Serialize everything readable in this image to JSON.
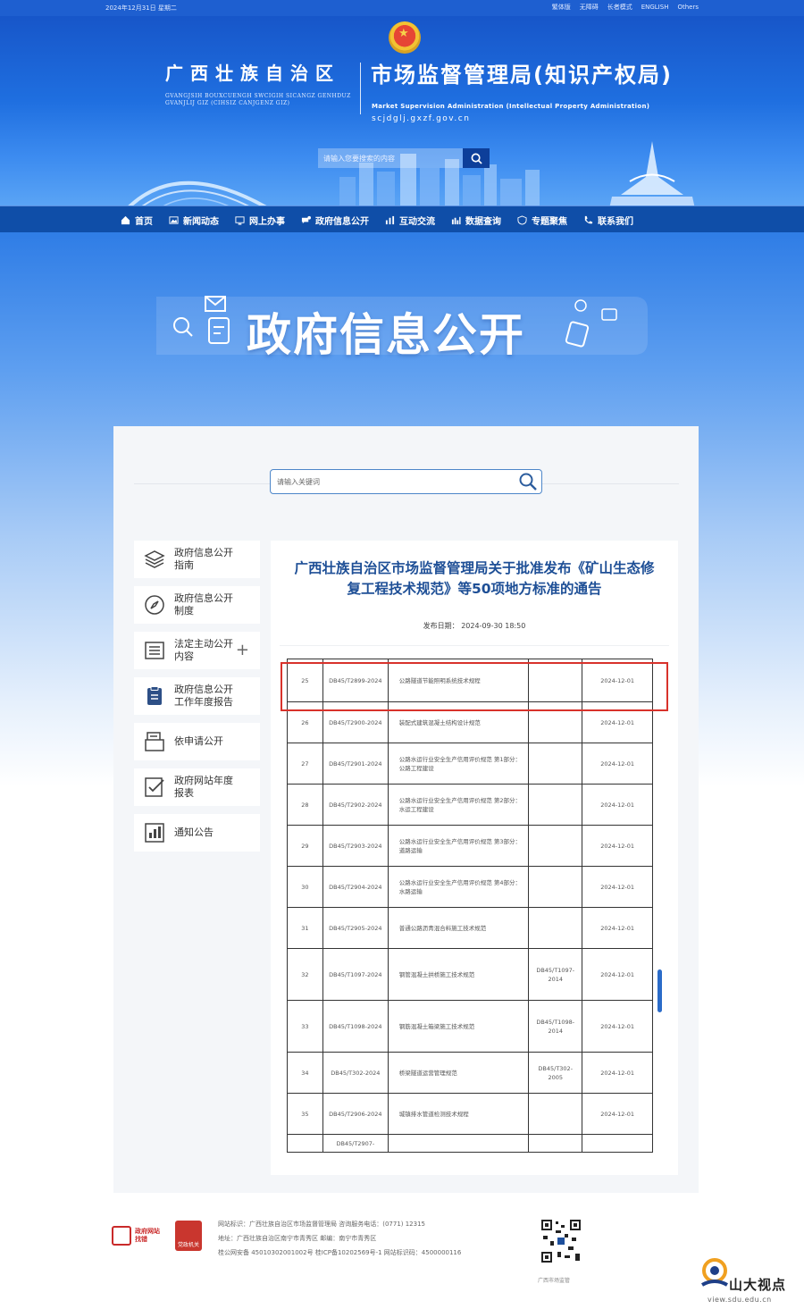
{
  "topbar": {
    "date": "2024年12月31日 星期二",
    "links": [
      "繁体版",
      "无障碍",
      "长者模式",
      "ENGLISH",
      "Others"
    ]
  },
  "header": {
    "region": "广西壮族自治区",
    "region_zhuang": "GVANGJSIH BOUXCUENGH SWCIGIH SICANGZ GENHDUZ GVANJLIJ GIZ (CIHSIZ CANJGENZ GIZ)",
    "agency": "市场监督管理局(知识产权局)",
    "agency_en": "Market Supervision Administration (Intellectual Property Administration)",
    "domain": "scjdglj.gxzf.gov.cn",
    "search_placeholder": "请输入您要搜索的内容"
  },
  "nav": {
    "items": [
      {
        "label": "首页",
        "icon": "home-icon"
      },
      {
        "label": "新闻动态",
        "icon": "image-icon"
      },
      {
        "label": "网上办事",
        "icon": "monitor-icon"
      },
      {
        "label": "政府信息公开",
        "icon": "chat-icon"
      },
      {
        "label": "互动交流",
        "icon": "bar-chart-icon"
      },
      {
        "label": "数据查询",
        "icon": "data-icon"
      },
      {
        "label": "专题聚焦",
        "icon": "shield-icon"
      },
      {
        "label": "联系我们",
        "icon": "phone-icon"
      }
    ]
  },
  "hero": {
    "title": "政府信息公开"
  },
  "content_search": {
    "placeholder": "请输入关键词"
  },
  "sidebar": {
    "items": [
      {
        "label": "政府信息公开指南",
        "icon": "layers-icon",
        "expandable": false
      },
      {
        "label": "政府信息公开制度",
        "icon": "compass-icon",
        "expandable": false
      },
      {
        "label": "法定主动公开内容",
        "icon": "list-icon",
        "expandable": true
      },
      {
        "label": "政府信息公开工作年度报告",
        "icon": "clipboard-icon",
        "expandable": false
      },
      {
        "label": "依申请公开",
        "icon": "document-icon",
        "expandable": false
      },
      {
        "label": "政府网站年度报表",
        "icon": "checklist-icon",
        "expandable": false
      },
      {
        "label": "通知公告",
        "icon": "report-icon",
        "expandable": false
      }
    ],
    "expand_symbol": "+"
  },
  "article": {
    "title": "广西壮族自治区市场监督管理局关于批准发布《矿山生态修复工程技术规范》等50项地方标准的通告",
    "publish_label": "发布日期：",
    "publish_date": "2024-09-30 18:50",
    "table_rows": [
      {
        "no": "25",
        "code": "DB45/T2899-2024",
        "name": "公路隧道节能照明系统技术规程",
        "replaces": "",
        "date": "2024-12-01"
      },
      {
        "no": "26",
        "code": "DB45/T2900-2024",
        "name": "装配式建筑混凝土结构设计规范",
        "replaces": "",
        "date": "2024-12-01"
      },
      {
        "no": "27",
        "code": "DB45/T2901-2024",
        "name": "公路水运行业安全生产信用评价规范 第1部分：公路工程建设",
        "replaces": "",
        "date": "2024-12-01"
      },
      {
        "no": "28",
        "code": "DB45/T2902-2024",
        "name": "公路水运行业安全生产信用评价规范 第2部分：水运工程建设",
        "replaces": "",
        "date": "2024-12-01"
      },
      {
        "no": "29",
        "code": "DB45/T2903-2024",
        "name": "公路水运行业安全生产信用评价规范 第3部分：道路运输",
        "replaces": "",
        "date": "2024-12-01"
      },
      {
        "no": "30",
        "code": "DB45/T2904-2024",
        "name": "公路水运行业安全生产信用评价规范 第4部分：水路运输",
        "replaces": "",
        "date": "2024-12-01"
      },
      {
        "no": "31",
        "code": "DB45/T2905-2024",
        "name": "普通公路沥青混合料施工技术规范",
        "replaces": "",
        "date": "2024-12-01"
      },
      {
        "no": "32",
        "code": "DB45/T1097-2024",
        "name": "钢管混凝土拱桥施工技术规范",
        "replaces": "DB45/T1097-2014",
        "date": "2024-12-01"
      },
      {
        "no": "33",
        "code": "DB45/T1098-2024",
        "name": "钢筋混凝土箱梁施工技术规范",
        "replaces": "DB45/T1098-2014",
        "date": "2024-12-01"
      },
      {
        "no": "34",
        "code": "DB45/T302-2024",
        "name": "桥梁隧道运营管理规范",
        "replaces": "DB45/T302-2005",
        "date": "2024-12-01"
      },
      {
        "no": "35",
        "code": "DB45/T2906-2024",
        "name": "城镇排水管道检测技术规程",
        "replaces": "",
        "date": "2024-12-01"
      },
      {
        "no": "",
        "code": "DB45/T2907-",
        "name": "",
        "replaces": "",
        "date": ""
      }
    ]
  },
  "footer": {
    "logo1_text": "政府网站找错",
    "logo2_text": "党政机关",
    "lines": [
      "网站标识：广西壮族自治区市场监督管理局  咨询服务电话：(0771) 12315",
      "地址：广西壮族自治区南宁市青秀区  邮编：南宁市青秀区",
      "桂公网安备 45010302001002号  桂ICP备10202569号-1  网站标识码：4500000116"
    ],
    "qr_caption": "广西市场监管"
  },
  "watermark": {
    "name": "山大视点",
    "url": "view.sdu.edu.cn"
  },
  "colors": {
    "primary": "#1e5fd0",
    "nav": "#0f4ea8",
    "title": "#1e4f96",
    "highlight": "#d8322b"
  }
}
